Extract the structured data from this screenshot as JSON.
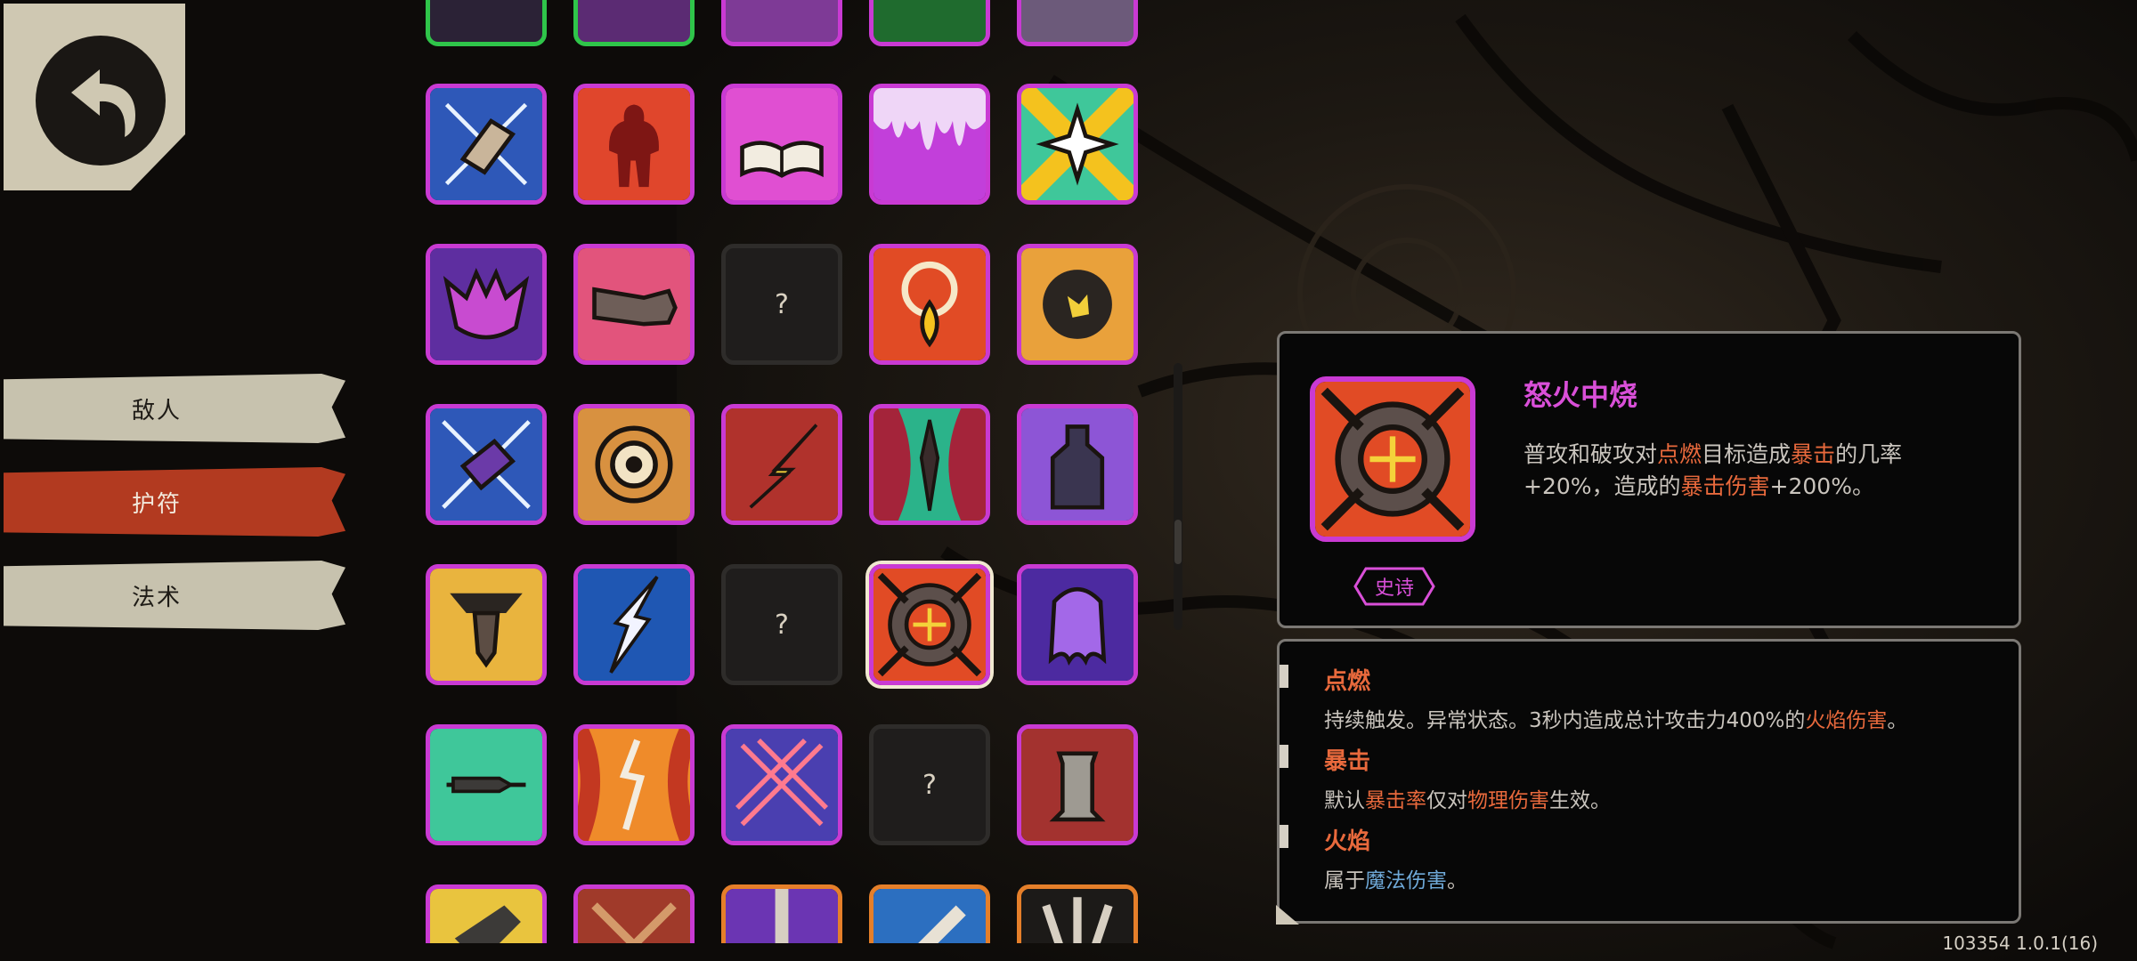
{
  "nav": {
    "tabs": [
      {
        "label": "敌人",
        "active": false
      },
      {
        "label": "护符",
        "active": true
      },
      {
        "label": "法术",
        "active": false
      }
    ]
  },
  "detail": {
    "name": "怒火中烧",
    "desc_parts": [
      "普攻和破攻对",
      "点燃",
      "目标造成",
      "暴击",
      "的几率+20%，造成的",
      "暴击伤害",
      "+200%。"
    ],
    "rarity": "史诗"
  },
  "glossary": [
    {
      "title": "点燃",
      "text_parts": [
        "持续触发。异常状态。3秒内造成总计攻击力400%的",
        "火焰伤害",
        "。"
      ]
    },
    {
      "title": "暴击",
      "text_parts": [
        "默认",
        "暴击率",
        "仅对",
        "物理伤害",
        "生效。"
      ]
    },
    {
      "title": "火焰",
      "text_parts": [
        "属于",
        "魔法伤害",
        "。"
      ]
    }
  ],
  "locked_label": "?",
  "version": "103354 1.0.1(16)",
  "colors": {
    "epic_border": "#c93ad3",
    "highlight": "#e8693c",
    "magic_blue": "#6fa9d8",
    "active_tab": "#b23a20"
  }
}
